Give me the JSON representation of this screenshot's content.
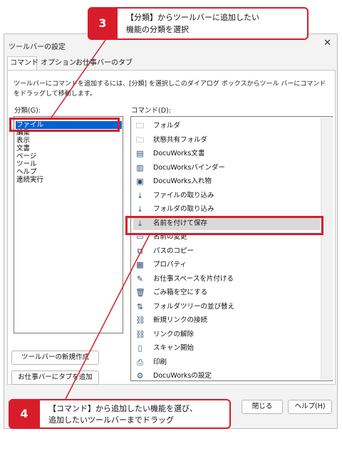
{
  "dialog": {
    "title": "ツールバーの設定",
    "close": "✕",
    "tabs": [
      {
        "label": "コマンド"
      },
      {
        "label": "オプション"
      },
      {
        "label": "お仕事バーのタブ"
      }
    ],
    "instructions": "ツールバーにコマンドを追加するには、[分類] を選択しこのダイアログ ボックスからツール バーにコマンドをドラッグして移動します。",
    "category_label": "分類(G):",
    "command_label": "コマンド(D):",
    "categories": [
      {
        "label": "ファイル",
        "selected": true
      },
      {
        "label": "編集"
      },
      {
        "label": "表示"
      },
      {
        "label": "文書"
      },
      {
        "label": "ページ"
      },
      {
        "label": "ツール"
      },
      {
        "label": "ヘルプ"
      },
      {
        "label": "連続実行"
      }
    ],
    "commands": [
      {
        "label": "フォルダ",
        "icon": "folder-icon",
        "glyph": "🗀"
      },
      {
        "label": "状態共有フォルダ",
        "icon": "shared-folder-icon",
        "glyph": "🗀"
      },
      {
        "label": "DocuWorks文書",
        "icon": "document-icon",
        "glyph": "▤"
      },
      {
        "label": "DocuWorksバインダー",
        "icon": "binder-icon",
        "glyph": "▥"
      },
      {
        "label": "DocuWorks入れ物",
        "icon": "container-icon",
        "glyph": "▣"
      },
      {
        "label": "ファイルの取り込み",
        "icon": "import-file-icon",
        "glyph": "⤓"
      },
      {
        "label": "フォルダの取り込み",
        "icon": "import-folder-icon",
        "glyph": "⤓"
      },
      {
        "label": "名前を付けて保存",
        "icon": "save-as-icon",
        "glyph": "⤓",
        "selected": true
      },
      {
        "label": "名前の変更",
        "icon": "rename-icon",
        "glyph": "▭"
      },
      {
        "label": "パスのコピー",
        "icon": "copy-path-icon",
        "glyph": "⧉"
      },
      {
        "label": "プロパティ",
        "icon": "properties-icon",
        "glyph": "▦"
      },
      {
        "label": "お仕事スペースを片付ける",
        "icon": "cleanup-icon",
        "glyph": "✎"
      },
      {
        "label": "ごみ箱を空にする",
        "icon": "trash-icon",
        "glyph": "🗑"
      },
      {
        "label": "フォルダツリーの並び替え",
        "icon": "sort-tree-icon",
        "glyph": "⇅"
      },
      {
        "label": "新規リンクの接続",
        "icon": "new-link-icon",
        "glyph": "⛓"
      },
      {
        "label": "リンクの解除",
        "icon": "unlink-icon",
        "glyph": "⛓"
      },
      {
        "label": "スキャン開始",
        "icon": "scan-icon",
        "glyph": "▯"
      },
      {
        "label": "印刷",
        "icon": "print-icon",
        "glyph": "⎙"
      },
      {
        "label": "DocuWorksの設定",
        "icon": "settings-icon",
        "glyph": "⚙"
      }
    ],
    "buttons": {
      "new_toolbar": "ツールバーの新規作成",
      "add_tab": "お仕事バーにタブを追加",
      "close": "閉じる",
      "help": "ヘルプ(H)"
    }
  },
  "callouts": [
    {
      "number": "3",
      "lines": [
        "【分類】からツールバーに追加したい",
        "機能の分類を選択"
      ]
    },
    {
      "number": "4",
      "lines": [
        "【コマンド】から追加したい機能を選び、",
        "追加したいツールバーまでドラッグ"
      ]
    }
  ],
  "colors": {
    "accent": "#d91c2a",
    "selection": "#0063d4"
  }
}
